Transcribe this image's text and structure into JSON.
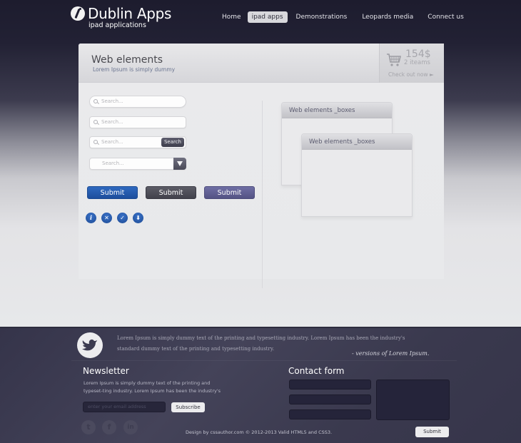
{
  "header": {
    "logo_title": "Dublin Apps",
    "logo_subtitle": "ipad applications",
    "nav": [
      {
        "label": "Home",
        "active": false
      },
      {
        "label": "ipad apps",
        "active": true
      },
      {
        "label": "Demonstrations",
        "active": false
      },
      {
        "label": "Leopards media",
        "active": false
      },
      {
        "label": "Connect us",
        "active": false
      }
    ]
  },
  "panel": {
    "title": "Web elements",
    "subtitle": "Lorem Ipsum is simply dummy",
    "cart": {
      "price": "154$",
      "items": "2 iteams",
      "checkout": "Check out now ►"
    },
    "searches": [
      {
        "placeholder": "Search...",
        "style": "rounded"
      },
      {
        "placeholder": "Search...",
        "style": "square"
      },
      {
        "placeholder": "Search...",
        "style": "with-button",
        "button": "Search"
      },
      {
        "placeholder": "Search...",
        "style": "dropdown"
      }
    ],
    "buttons": [
      {
        "label": "Submit",
        "color": "#2a5fb3"
      },
      {
        "label": "Submit",
        "color": "#4e4e58"
      },
      {
        "label": "Submit",
        "color": "#605f94"
      }
    ],
    "icons": [
      {
        "name": "info",
        "glyph": "i"
      },
      {
        "name": "close",
        "glyph": "✕"
      },
      {
        "name": "check",
        "glyph": "✓"
      },
      {
        "name": "download",
        "glyph": "⬇"
      }
    ],
    "boxes": [
      {
        "title": "Web elements _boxes"
      },
      {
        "title": "Web elements _boxes"
      }
    ]
  },
  "footer": {
    "quote": "Lorem Ipsum is simply dummy text of the printing and typesetting industry. Lorem Ipsum has been the industry's standard dummy text  of the printing and typesetting industry.",
    "quote_author": "- versions of Lorem Ipsum.",
    "newsletter": {
      "title": "Newsletter",
      "text": "Lorem Ipsum is simply dummy text of the printing and typeset-ting industry. Lorem Ipsum has been the industry's",
      "placeholder": "enter your email address",
      "button": "Subscribe"
    },
    "social": [
      {
        "name": "twitter",
        "glyph": "t"
      },
      {
        "name": "facebook",
        "glyph": "f"
      },
      {
        "name": "linkedin",
        "glyph": "in"
      }
    ],
    "copyright": "Design by cssauthor.com © 2012-2013  Valid HTML5 and CSS3.",
    "contact": {
      "title": "Contact form",
      "submit": "Submit"
    }
  }
}
